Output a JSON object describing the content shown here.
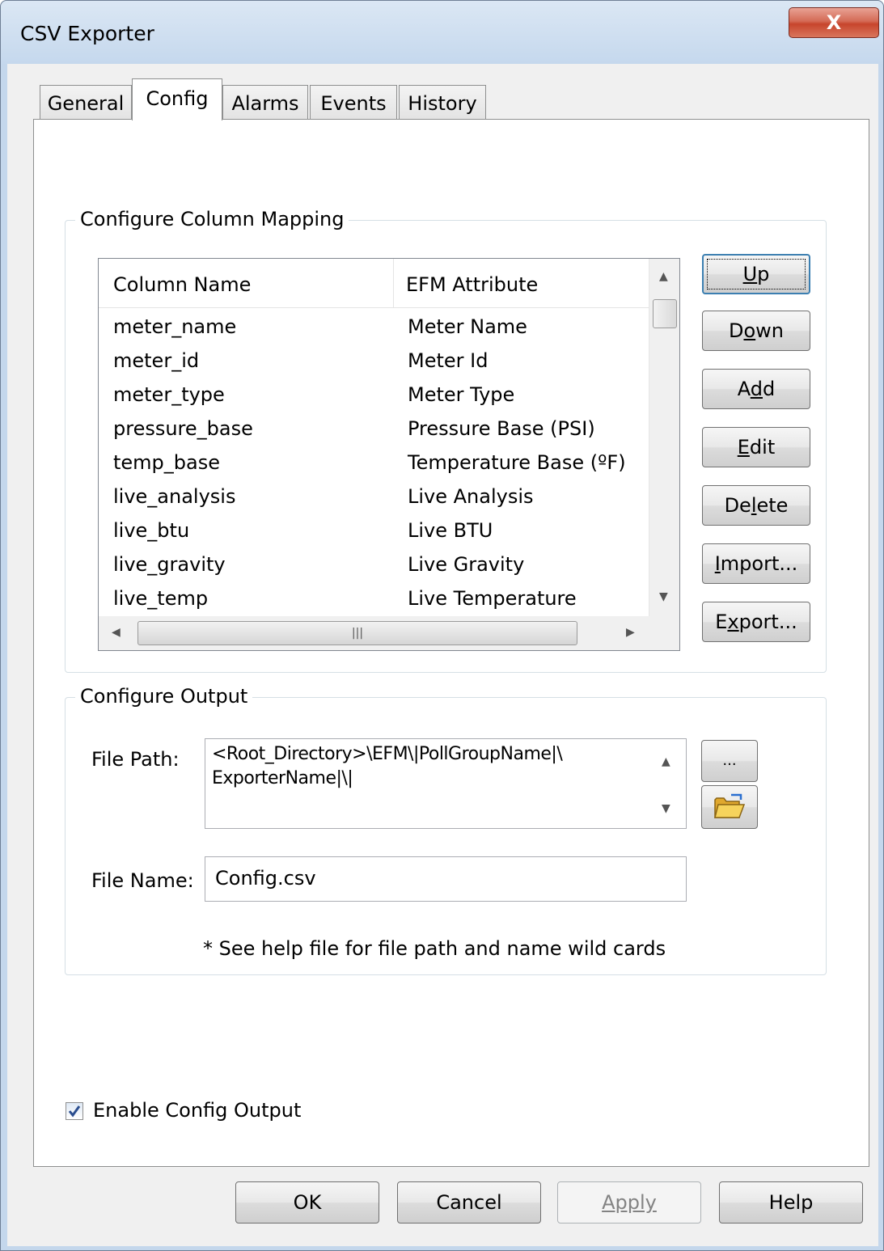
{
  "window": {
    "title": "CSV Exporter",
    "close_glyph": "X"
  },
  "tabs": [
    {
      "label": "General"
    },
    {
      "label": "Config"
    },
    {
      "label": "Alarms"
    },
    {
      "label": "Events"
    },
    {
      "label": "History"
    }
  ],
  "mapping": {
    "group_label": "Configure Column Mapping",
    "columns": [
      "Column Name",
      "EFM Attribute"
    ],
    "rows": [
      [
        "meter_name",
        "Meter Name"
      ],
      [
        "meter_id",
        "Meter Id"
      ],
      [
        "meter_type",
        "Meter Type"
      ],
      [
        "pressure_base",
        "Pressure Base (PSI)"
      ],
      [
        "temp_base",
        "Temperature Base (ºF)"
      ],
      [
        "live_analysis",
        "Live Analysis"
      ],
      [
        "live_btu",
        "Live BTU"
      ],
      [
        "live_gravity",
        "Live Gravity"
      ],
      [
        "live_temp",
        "Live Temperature"
      ]
    ],
    "buttons": {
      "up": {
        "pre": "",
        "key": "U",
        "post": "p"
      },
      "down": {
        "pre": "D",
        "key": "o",
        "post": "wn"
      },
      "add": {
        "pre": "A",
        "key": "d",
        "post": "d"
      },
      "edit": {
        "pre": "",
        "key": "E",
        "post": "dit"
      },
      "delete": {
        "pre": "De",
        "key": "l",
        "post": "ete"
      },
      "import": {
        "pre": "",
        "key": "I",
        "post": "mport..."
      },
      "export": {
        "pre": "E",
        "key": "x",
        "post": "port..."
      }
    }
  },
  "output": {
    "group_label": "Configure Output",
    "file_path_label": "File Path:",
    "file_path_line1": "<Root_Directory>\\EFM\\|PollGroupName|\\",
    "file_path_line2": "ExporterName|\\|",
    "browse_label": "...",
    "file_name_label": "File Name:",
    "file_name_value": "Config.csv",
    "hint": "* See help file for file path and name wild cards"
  },
  "enable_output": {
    "label": "Enable Config Output",
    "checked": true
  },
  "footer": {
    "ok": "OK",
    "cancel": "Cancel",
    "apply": "Apply",
    "help": "Help"
  }
}
